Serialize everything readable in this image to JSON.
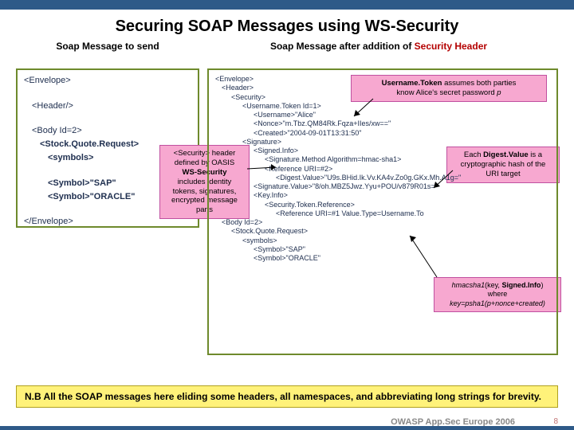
{
  "title": "Securing SOAP Messages using WS-Security",
  "left_heading": "Soap Message to send",
  "right_heading_a": "Soap Message after addition of ",
  "right_heading_b": "Security Header",
  "left": {
    "l1": "<Envelope>",
    "l2": "<Header/>",
    "l3": "<Body Id=2>",
    "l4": "<Stock.Quote.Request>",
    "l5": "<symbols>",
    "l6": "<Symbol>\"SAP\"",
    "l7": "<Symbol>\"ORACLE\"",
    "l8": "</Envelope>"
  },
  "callout1": {
    "a": "<Security> header",
    "b": "defined by OASIS",
    "c": "WS-Security",
    "d": "includes identity",
    "e": "tokens, signatures,",
    "f": "encrypted message",
    "g": "parts"
  },
  "callout2": {
    "a": "Username.Token",
    "b": " assumes both parties",
    "c": "know Alice's secret password ",
    "d": "p"
  },
  "callout3": {
    "a": "Each ",
    "b": "Digest.Value",
    "c": " is a",
    "d": "cryptographic hash of the",
    "e": "URI target"
  },
  "callout4": {
    "a": "hmacsha1",
    "b": "(key, ",
    "c": "Signed.Info",
    "d": ")",
    "e": "where",
    "f": "key=psha1(p+nonce+created)"
  },
  "xml": {
    "x01": "<Envelope>",
    "x02": "<Header>",
    "x03": "<Security>",
    "x04": "<Username.Token Id=1>",
    "x05": "<Username>\"Alice\"",
    "x06": "<Nonce>\"m.Tbz.QM84Rk.Fqza+IIes/xw==\"",
    "x07": "<Created>\"2004-09-01T13:31:50\"",
    "x08": "<Signature>",
    "x09": "<Signed.Info>",
    "x10": "<Signature.Method Algorithm=hmac-sha1>",
    "x11": "<Reference URI=#2>",
    "x12": "<Digest.Value>\"U9s.BHid.Ik.Vv.KA4v.Zo0g.GKx.Mh.A1g=\"",
    "x13": "<Signature.Value>\"8/oh.MBZ5Jwz.Yyu+POU/v879R01s=\"",
    "x14": "<Key.Info>",
    "x15": "<Security.Token.Reference>",
    "x16": "<Reference URI=#1 Value.Type=Username.To",
    "x17": "<Body Id=2>",
    "x18": "<Stock.Quote.Request>",
    "x19": "<symbols>",
    "x20": "<Symbol>\"SAP\"",
    "x21": "<Symbol>\"ORACLE\""
  },
  "note": "N.B All the SOAP messages here eliding some headers, all namespaces, and abbreviating long strings for brevity.",
  "footer": "OWASP App.Sec Europe 2006",
  "page": "8"
}
